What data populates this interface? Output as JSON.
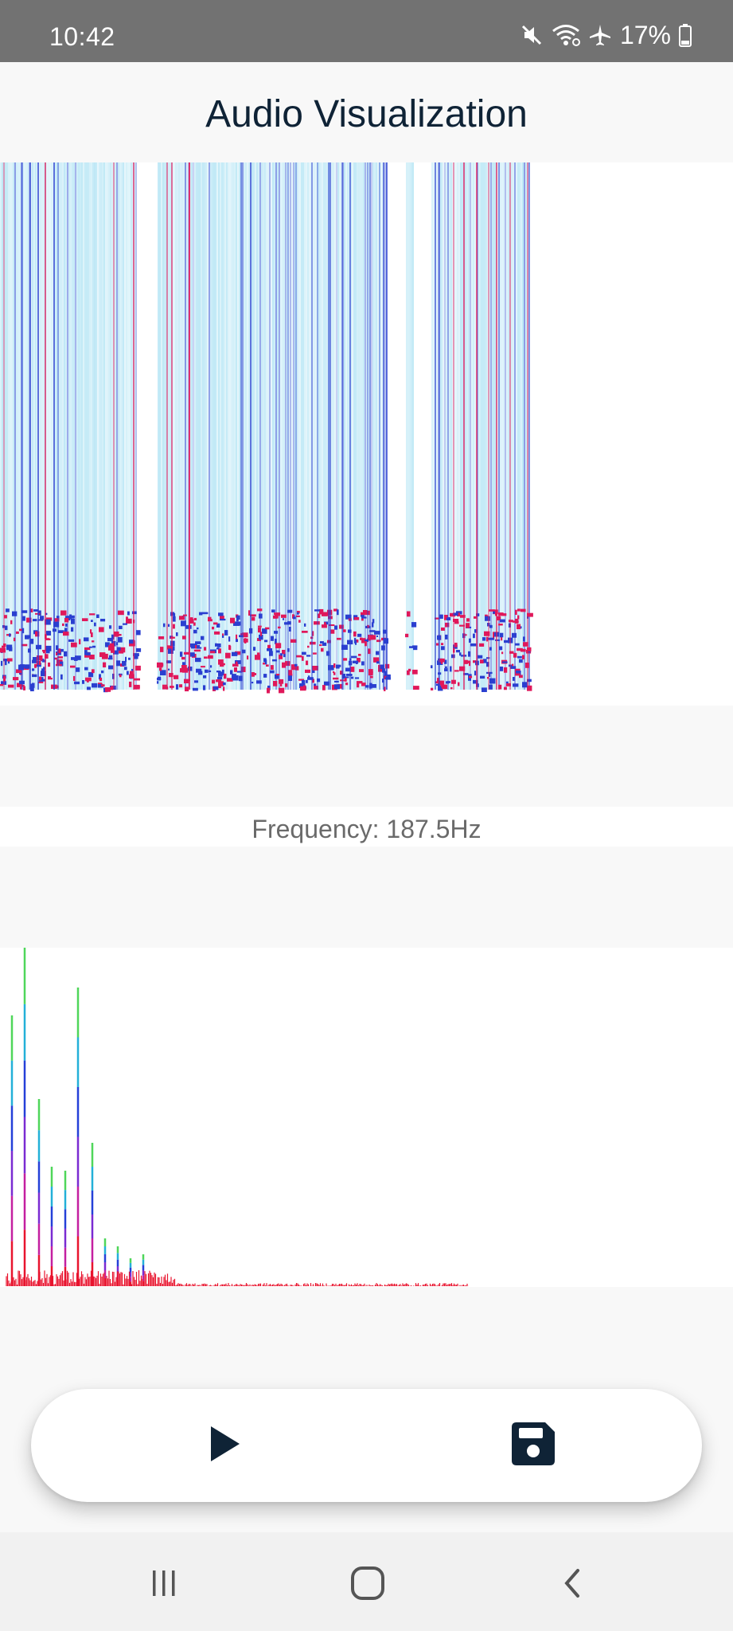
{
  "status_bar": {
    "time": "10:42",
    "battery": "17%",
    "icons": [
      "mute-icon",
      "wifi-icon",
      "airplane-icon",
      "battery-icon"
    ]
  },
  "app": {
    "title": "Audio Visualization"
  },
  "frequency": {
    "label": "Frequency: 187.5Hz"
  },
  "visuals": {
    "spectrogram": "spectrogram-image",
    "spectrum": "frequency-spectrum-image"
  },
  "controls": {
    "play_icon": "play-icon",
    "save_icon": "save-icon"
  },
  "nav": {
    "icons": [
      "recent-apps-icon",
      "home-icon",
      "back-icon"
    ]
  },
  "colors": {
    "title": "#0f2336",
    "status_bar": "#727272",
    "icon": "#0f2336",
    "spectrogram_low": "#b8e6f5",
    "spectrogram_mid": "#2a3fd0",
    "spectrogram_high": "#e0185a"
  }
}
